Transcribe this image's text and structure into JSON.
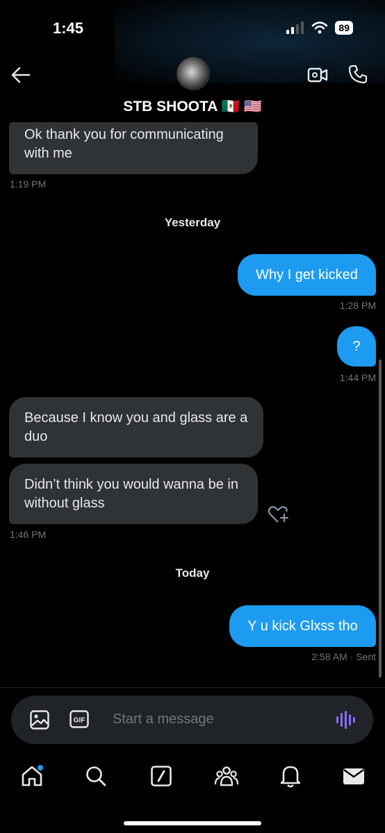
{
  "status_bar": {
    "time": "1:45",
    "battery": "89"
  },
  "header": {
    "contact_name": "STB SHOOTA 🇲🇽 🇺🇸",
    "icons": [
      "back-arrow-icon",
      "video-call-icon",
      "phone-call-icon"
    ]
  },
  "messages": [
    {
      "direction": "in",
      "text": "Ok thank you for communicating with me",
      "time": "1:19 PM"
    },
    {
      "day_separator": "Yesterday"
    },
    {
      "direction": "out",
      "text": "Why I get kicked",
      "time": "1:28 PM"
    },
    {
      "direction": "out",
      "text": "?",
      "time": "1:44 PM"
    },
    {
      "direction": "in",
      "text": "Because I know you and glass are a  duo"
    },
    {
      "direction": "in",
      "text": "Didn’t think you would wanna be in without glass",
      "time": "1:46 PM"
    },
    {
      "day_separator": "Today"
    },
    {
      "direction": "out",
      "text": "Y u kick Glxss tho",
      "time": "2:58 AM",
      "status": "· Sent"
    }
  ],
  "composer": {
    "placeholder": "Start a message",
    "gif_label": "GIF"
  },
  "tabs": [
    "home-icon",
    "search-icon",
    "compose-icon",
    "communities-icon",
    "notifications-icon",
    "messages-icon"
  ],
  "colors": {
    "accent": "#1d9bf0",
    "incoming_bubble": "#2f3336",
    "background": "#000000",
    "voice_accent": "#8f6bff"
  }
}
